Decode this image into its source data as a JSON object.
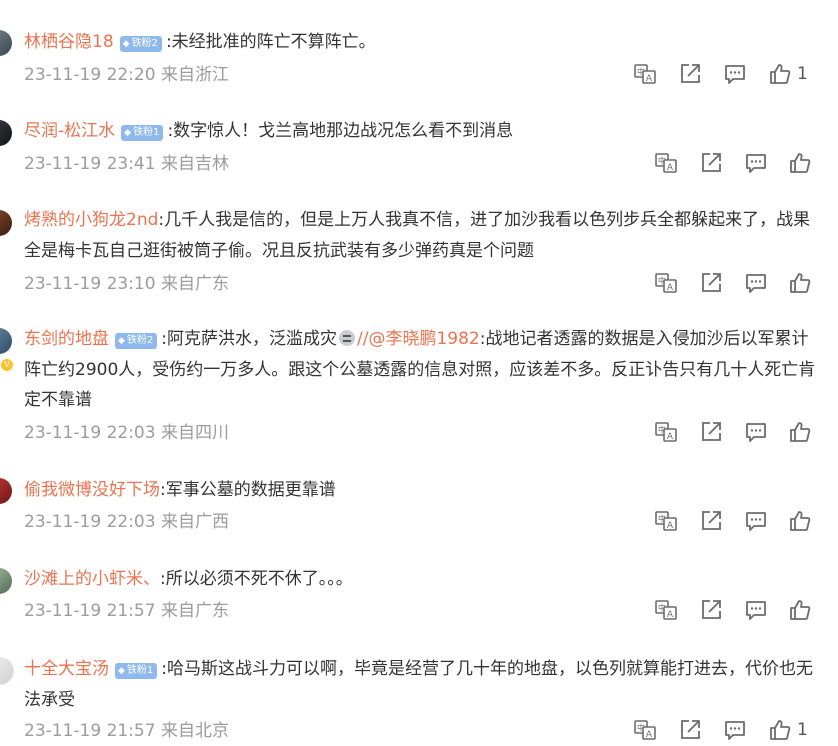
{
  "colors": {
    "username": "#eb7350",
    "meta": "#9c9c9c",
    "badge": "#8fb9ec",
    "icon": "#6c6c6c"
  },
  "icons": [
    "translate-icon",
    "share-icon",
    "comment-icon",
    "like-icon"
  ],
  "comments": [
    {
      "username": "林栖谷隐18",
      "badge": "铁粉2",
      "text": ":未经批准的阵亡不算阵亡。",
      "date": "23-11-19 22:20",
      "location": "来自浙江",
      "likes": "1"
    },
    {
      "username": "尽润-松江水",
      "badge": "铁粉1",
      "text": ":数字惊人！戈兰高地那边战况怎么看不到消息",
      "date": "23-11-19 23:41",
      "location": "来自吉林",
      "likes": ""
    },
    {
      "username": "烤熟的小狗龙2nd",
      "badge": "",
      "text": ":几千人我是信的，但是上万人我真不信，进了加沙我看以色列步兵全都躲起来了，战果全是梅卡瓦自己逛街被筒子偷。况且反抗武装有多少弹药真是个问题",
      "date": "23-11-19 23:10",
      "location": "来自广东",
      "likes": ""
    },
    {
      "username": "东剑的地盘",
      "badge": "铁粉2",
      "text_before": ":阿克萨洪水，泛滥成灾",
      "mention": "//@李晓鹏1982",
      "text": ":战地记者透露的数据是入侵加沙后以军累计阵亡约2900人，受伤约一万多人。跟这个公墓透露的信息对照，应该差不多。反正讣告只有几十人死亡肯定不靠谱",
      "date": "23-11-19 22:03",
      "location": "来自四川",
      "likes": ""
    },
    {
      "username": "偷我微博没好下场",
      "badge": "",
      "text": ":军事公墓的数据更靠谱",
      "date": "23-11-19 22:03",
      "location": "来自广西",
      "likes": ""
    },
    {
      "username": "沙滩上的小虾米、",
      "badge": "",
      "text": ":所以必须不死不休了。。。",
      "date": "23-11-19 21:57",
      "location": "来自广东",
      "likes": ""
    },
    {
      "username": "十全大宝汤",
      "badge": "铁粉1",
      "text": ":哈马斯这战斗力可以啊，毕竟是经营了几十年的地盘，以色列就算能打进去，代价也无法承受",
      "date": "23-11-19 21:57",
      "location": "来自北京",
      "likes": "1"
    }
  ]
}
